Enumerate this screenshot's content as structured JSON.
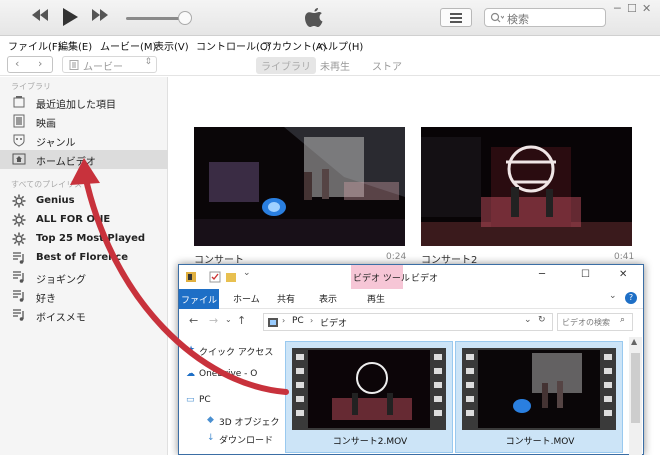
{
  "search": {
    "placeholder": "検索"
  },
  "menu": [
    "ファイル(F)",
    "編集(E)",
    "ムービー(M)",
    "表示(V)",
    "コントロール(C)",
    "アカウント(A)",
    "ヘルプ(H)"
  ],
  "nav": {
    "media_kind": "ムービー",
    "segments": [
      "ライブラリ",
      "未再生",
      "ストア"
    ],
    "active_segment": 0
  },
  "sidebar": {
    "library_header": "ライブラリ",
    "library_items": [
      {
        "label": "最近追加した項目",
        "icon": "recent-icon"
      },
      {
        "label": "映画",
        "icon": "film-icon"
      },
      {
        "label": "ジャンル",
        "icon": "genre-icon"
      },
      {
        "label": "ホームビデオ",
        "icon": "home-video-icon",
        "selected": true
      }
    ],
    "playlists_header": "すべてのプレイリスト",
    "playlist_items": [
      {
        "label": "Genius",
        "icon": "genius-icon"
      },
      {
        "label": "ALL FOR ONE",
        "icon": "genius-icon"
      },
      {
        "label": "Top 25 Most Played",
        "icon": "smart-playlist-icon"
      },
      {
        "label": "Best of Florence",
        "icon": "playlist-icon"
      },
      {
        "label": "ジョギング",
        "icon": "playlist-icon"
      },
      {
        "label": "好き",
        "icon": "playlist-icon"
      },
      {
        "label": "ボイスメモ",
        "icon": "playlist-icon"
      }
    ]
  },
  "videos": [
    {
      "title": "コンサート",
      "duration": "0:24"
    },
    {
      "title": "コンサート2",
      "duration": "0:41"
    }
  ],
  "explorer": {
    "title": "ビデオ",
    "context_tab": "ビデオ ツール",
    "ribbon_tabs": [
      "ファイル",
      "ホーム",
      "共有",
      "表示",
      "再生"
    ],
    "breadcrumb": [
      "PC",
      "ビデオ"
    ],
    "search_placeholder": "ビデオの検索",
    "nav_items": [
      "クイック アクセス",
      "OneDrive - O",
      "PC",
      "3D オブジェク",
      "ダウンロード"
    ],
    "files": [
      "コンサート2.MOV",
      "コンサート.MOV"
    ]
  },
  "colors": {
    "arrow": "#c8323c",
    "ribbon_file": "#1e6fc6",
    "selection": "#cce4f7",
    "context_tab": "#f6c6d6"
  }
}
